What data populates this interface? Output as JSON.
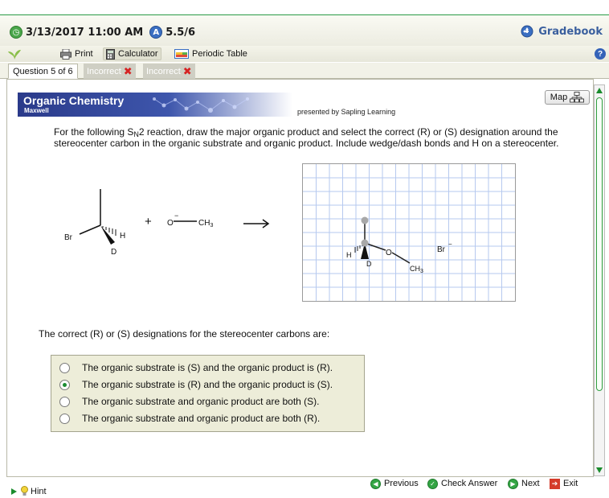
{
  "header": {
    "datetime": "3/13/2017 11:00 AM",
    "score": "5.5/6",
    "gradebook_label": "Gradebook"
  },
  "toolbar": {
    "print_label": "Print",
    "calculator_label": "Calculator",
    "periodic_table_label": "Periodic Table"
  },
  "tabs": [
    {
      "label": "Question 5 of 6"
    },
    {
      "label": "Incorrect"
    },
    {
      "label": "Incorrect"
    }
  ],
  "banner": {
    "title": "Organic Chemistry",
    "subtitle": "Maxwell",
    "presented_by": "presented by Sapling Learning",
    "map_label": "Map"
  },
  "question": {
    "text_before_subscript": "For the following S",
    "subscript": "N",
    "text_after_subscript": "2 reaction, draw the major organic product and select the correct (R) or (S) designation around the stereocenter carbon in the organic substrate and organic product. Include wedge/dash bonds and H on a stereocenter."
  },
  "molecule_labels": {
    "br": "Br",
    "h": "H",
    "d": "D",
    "plus": "+",
    "oxygen": "O",
    "minus": "−",
    "ch3_c": "CH",
    "ch3_sub": "3"
  },
  "drawing_labels": {
    "h": "H",
    "d": "D",
    "o": "O",
    "ch3_c": "CH",
    "ch3_sub": "3",
    "br": "Br",
    "br_charge": "−"
  },
  "rs_prompt": "The correct (R) or (S) designations for the stereocenter carbons are:",
  "choices": [
    {
      "label": "The organic substrate is (S) and the organic product is (R).",
      "selected": false
    },
    {
      "label": "The organic substrate is (R) and the organic product is (S).",
      "selected": true
    },
    {
      "label": "The organic substrate and organic product are both (S).",
      "selected": false
    },
    {
      "label": "The organic substrate and organic product are both (R).",
      "selected": false
    }
  ],
  "footer": {
    "hint_label": "Hint",
    "previous_label": "Previous",
    "check_answer_label": "Check Answer",
    "next_label": "Next",
    "exit_label": "Exit"
  },
  "colors": {
    "accent_green": "#2a9a46",
    "banner_blue": "#2a3a8a",
    "incorrect_red": "#d62222",
    "link_blue": "#3a5f9e"
  }
}
